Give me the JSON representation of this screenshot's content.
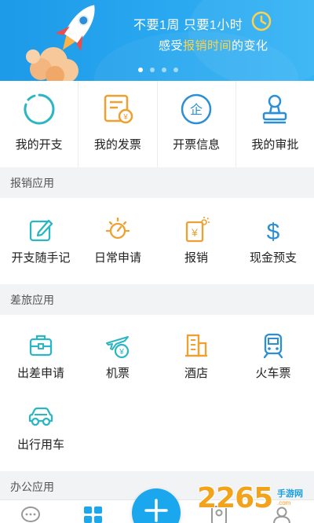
{
  "banner": {
    "headline": "不要1周 只要1小时",
    "subline_prefix": "感受",
    "subline_highlight": "报销时间",
    "subline_suffix": "的变化",
    "page_dots": 4,
    "active_dot": 1,
    "accent_color": "#ffd24a"
  },
  "top_grid": [
    {
      "label": "我的开支",
      "icon": "spinner-ring-icon"
    },
    {
      "label": "我的发票",
      "icon": "invoice-icon"
    },
    {
      "label": "开票信息",
      "icon": "company-seal-icon"
    },
    {
      "label": "我的审批",
      "icon": "approval-stamp-icon"
    }
  ],
  "sections": {
    "reimbursement": {
      "title": "报销应用",
      "items": [
        {
          "label": "开支随手记",
          "icon": "edit-note-icon"
        },
        {
          "label": "日常申请",
          "icon": "sun-compass-icon"
        },
        {
          "label": "报销",
          "icon": "yuan-receipt-icon"
        },
        {
          "label": "现金预支",
          "icon": "dollar-icon"
        }
      ]
    },
    "travel": {
      "title": "差旅应用",
      "items": [
        {
          "label": "出差申请",
          "icon": "briefcase-icon"
        },
        {
          "label": "机票",
          "icon": "airplane-icon"
        },
        {
          "label": "酒店",
          "icon": "hotel-building-icon"
        },
        {
          "label": "火车票",
          "icon": "train-icon"
        },
        {
          "label": "出行用车",
          "icon": "car-icon"
        }
      ]
    },
    "office": {
      "title": "办公应用"
    }
  },
  "bottom_nav": [
    {
      "icon": "chat-bubble-icon"
    },
    {
      "icon": "apps-grid-icon"
    },
    {
      "icon": "add-icon"
    },
    {
      "icon": "contacts-icon"
    },
    {
      "icon": "profile-icon"
    }
  ],
  "watermark": {
    "number": "2265",
    "site_text": "手游网",
    "url": ".com"
  },
  "colors": {
    "brand_blue": "#1ba7ee",
    "icon_teal": "#2bb6c4",
    "icon_orange": "#f0a030",
    "icon_blue": "#2a8fd8"
  }
}
